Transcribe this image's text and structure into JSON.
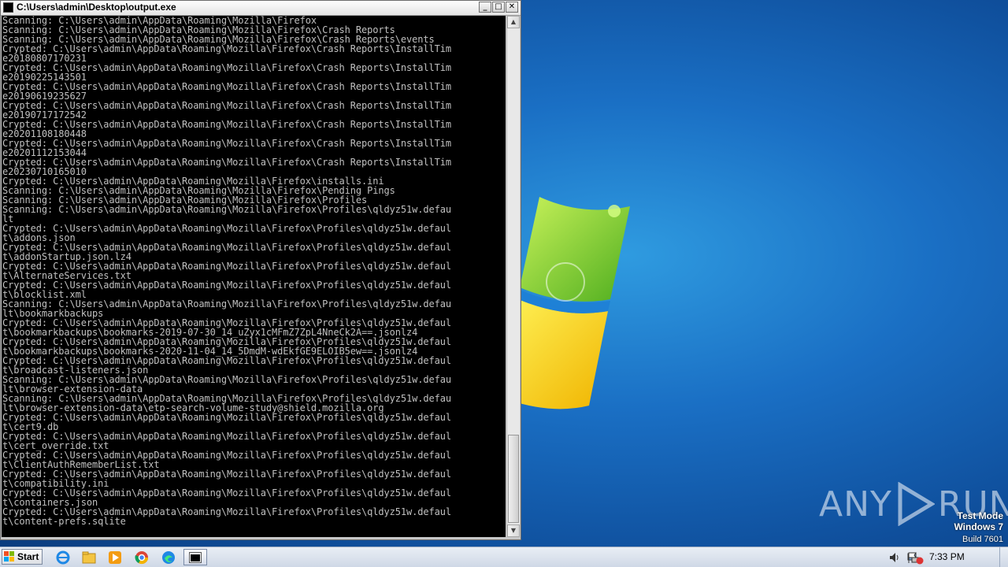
{
  "window": {
    "title": "C:\\Users\\admin\\Desktop\\output.exe",
    "minimize": "_",
    "maximize": "□",
    "close": "✕"
  },
  "console": {
    "lines": [
      "Scanning: C:\\Users\\admin\\AppData\\Roaming\\Mozilla\\Firefox",
      "Scanning: C:\\Users\\admin\\AppData\\Roaming\\Mozilla\\Firefox\\Crash Reports",
      "Scanning: C:\\Users\\admin\\AppData\\Roaming\\Mozilla\\Firefox\\Crash Reports\\events",
      "Crypted: C:\\Users\\admin\\AppData\\Roaming\\Mozilla\\Firefox\\Crash Reports\\InstallTim",
      "e20180807170231",
      "Crypted: C:\\Users\\admin\\AppData\\Roaming\\Mozilla\\Firefox\\Crash Reports\\InstallTim",
      "e20190225143501",
      "Crypted: C:\\Users\\admin\\AppData\\Roaming\\Mozilla\\Firefox\\Crash Reports\\InstallTim",
      "e20190619235627",
      "Crypted: C:\\Users\\admin\\AppData\\Roaming\\Mozilla\\Firefox\\Crash Reports\\InstallTim",
      "e20190717172542",
      "Crypted: C:\\Users\\admin\\AppData\\Roaming\\Mozilla\\Firefox\\Crash Reports\\InstallTim",
      "e20201108180448",
      "Crypted: C:\\Users\\admin\\AppData\\Roaming\\Mozilla\\Firefox\\Crash Reports\\InstallTim",
      "e20201112153044",
      "Crypted: C:\\Users\\admin\\AppData\\Roaming\\Mozilla\\Firefox\\Crash Reports\\InstallTim",
      "e20230710165010",
      "Crypted: C:\\Users\\admin\\AppData\\Roaming\\Mozilla\\Firefox\\installs.ini",
      "Scanning: C:\\Users\\admin\\AppData\\Roaming\\Mozilla\\Firefox\\Pending Pings",
      "Scanning: C:\\Users\\admin\\AppData\\Roaming\\Mozilla\\Firefox\\Profiles",
      "Scanning: C:\\Users\\admin\\AppData\\Roaming\\Mozilla\\Firefox\\Profiles\\qldyz51w.defau",
      "lt",
      "Crypted: C:\\Users\\admin\\AppData\\Roaming\\Mozilla\\Firefox\\Profiles\\qldyz51w.defaul",
      "t\\addons.json",
      "Crypted: C:\\Users\\admin\\AppData\\Roaming\\Mozilla\\Firefox\\Profiles\\qldyz51w.defaul",
      "t\\addonStartup.json.lz4",
      "Crypted: C:\\Users\\admin\\AppData\\Roaming\\Mozilla\\Firefox\\Profiles\\qldyz51w.defaul",
      "t\\AlternateServices.txt",
      "Crypted: C:\\Users\\admin\\AppData\\Roaming\\Mozilla\\Firefox\\Profiles\\qldyz51w.defaul",
      "t\\blocklist.xml",
      "Scanning: C:\\Users\\admin\\AppData\\Roaming\\Mozilla\\Firefox\\Profiles\\qldyz51w.defau",
      "lt\\bookmarkbackups",
      "Crypted: C:\\Users\\admin\\AppData\\Roaming\\Mozilla\\Firefox\\Profiles\\qldyz51w.defaul",
      "t\\bookmarkbackups\\bookmarks-2019-07-30_14_uZyx1cMFmZ7ZpL4NneCk2A==.jsonlz4",
      "Crypted: C:\\Users\\admin\\AppData\\Roaming\\Mozilla\\Firefox\\Profiles\\qldyz51w.defaul",
      "t\\bookmarkbackups\\bookmarks-2020-11-04_14_5DmdM-wdEkfGE9ELOIB5ew==.jsonlz4",
      "Crypted: C:\\Users\\admin\\AppData\\Roaming\\Mozilla\\Firefox\\Profiles\\qldyz51w.defaul",
      "t\\broadcast-listeners.json",
      "Scanning: C:\\Users\\admin\\AppData\\Roaming\\Mozilla\\Firefox\\Profiles\\qldyz51w.defau",
      "lt\\browser-extension-data",
      "Scanning: C:\\Users\\admin\\AppData\\Roaming\\Mozilla\\Firefox\\Profiles\\qldyz51w.defau",
      "lt\\browser-extension-data\\etp-search-volume-study@shield.mozilla.org",
      "Crypted: C:\\Users\\admin\\AppData\\Roaming\\Mozilla\\Firefox\\Profiles\\qldyz51w.defaul",
      "t\\cert9.db",
      "Crypted: C:\\Users\\admin\\AppData\\Roaming\\Mozilla\\Firefox\\Profiles\\qldyz51w.defaul",
      "t\\cert_override.txt",
      "Crypted: C:\\Users\\admin\\AppData\\Roaming\\Mozilla\\Firefox\\Profiles\\qldyz51w.defaul",
      "t\\ClientAuthRememberList.txt",
      "Crypted: C:\\Users\\admin\\AppData\\Roaming\\Mozilla\\Firefox\\Profiles\\qldyz51w.defaul",
      "t\\compatibility.ini",
      "Crypted: C:\\Users\\admin\\AppData\\Roaming\\Mozilla\\Firefox\\Profiles\\qldyz51w.defaul",
      "t\\containers.json",
      "Crypted: C:\\Users\\admin\\AppData\\Roaming\\Mozilla\\Firefox\\Profiles\\qldyz51w.defaul",
      "t\\content-prefs.sqlite"
    ]
  },
  "desktop": {
    "watermark_left": "ANY",
    "watermark_right": "RUN",
    "test_mode": "Test Mode",
    "os_name": "Windows 7",
    "build": "Build 7601"
  },
  "taskbar": {
    "start_label": "Start",
    "clock": "7:33 PM",
    "icons": [
      "ie-icon",
      "explorer-icon",
      "media-player-icon",
      "chrome-icon",
      "edge-icon",
      "console-icon"
    ]
  },
  "colors": {
    "console_bg": "#000000",
    "console_text": "#c0c0c0",
    "desktop_blue": "#1a6fc4"
  }
}
